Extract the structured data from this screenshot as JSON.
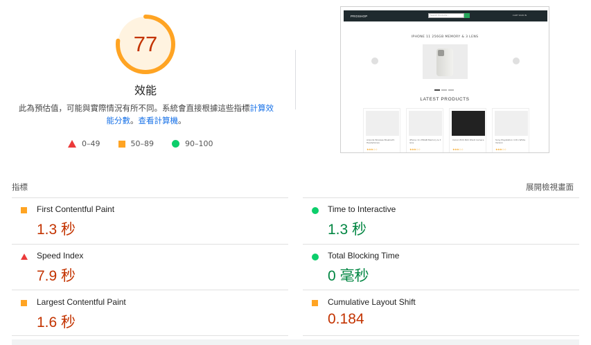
{
  "score": {
    "value": "77",
    "fraction": 0.77,
    "label": "效能",
    "ring_color": "#ffa423",
    "bg_color": "#fff3e0",
    "text_color": "#c33300"
  },
  "summary": {
    "text": "此為預估值，可能與實際情況有所不同。系統會直接根據這些指標",
    "link1": "計算效能分數",
    "sep": "。",
    "link2": "查看計算機",
    "end": "。"
  },
  "legend": [
    {
      "icon": "triangle-red",
      "label": "0–49"
    },
    {
      "icon": "square-orange",
      "label": "50–89"
    },
    {
      "icon": "circle-green",
      "label": "90–100"
    }
  ],
  "thumbnail": {
    "logo": "PROSHOP",
    "search_placeholder": "Search Products...",
    "nav_links": "CART  SIGN IN",
    "hero_title": "IPHONE 11 256GB MEMORY & 3 LENS",
    "latest_title": "LATEST PRODUCTS",
    "products": [
      {
        "name": "Airpods Wireless Bluetooth Headphones"
      },
      {
        "name": "iPhone 11 256GB Memory & 3 lens"
      },
      {
        "name": "Canon EOS 80D DSLR Camera"
      },
      {
        "name": "Sony Playstation 4 Pro White Version"
      }
    ],
    "stars": "★★★☆☆"
  },
  "metrics": {
    "title": "指標",
    "expand_label": "展開檢視畫面",
    "items": [
      {
        "name": "First Contentful Paint",
        "value": "1.3 秒",
        "status": "orange"
      },
      {
        "name": "Time to Interactive",
        "value": "1.3 秒",
        "status": "green"
      },
      {
        "name": "Speed Index",
        "value": "7.9 秒",
        "status": "red"
      },
      {
        "name": "Total Blocking Time",
        "value": "0 毫秒",
        "status": "green"
      },
      {
        "name": "Largest Contentful Paint",
        "value": "1.6 秒",
        "status": "orange"
      },
      {
        "name": "Cumulative Layout Shift",
        "value": "0.184",
        "status": "orange"
      }
    ]
  },
  "colors": {
    "red": "#eb3a3a",
    "orange": "#ffa423",
    "green": "#0cce6b",
    "link": "#1a73e8"
  }
}
